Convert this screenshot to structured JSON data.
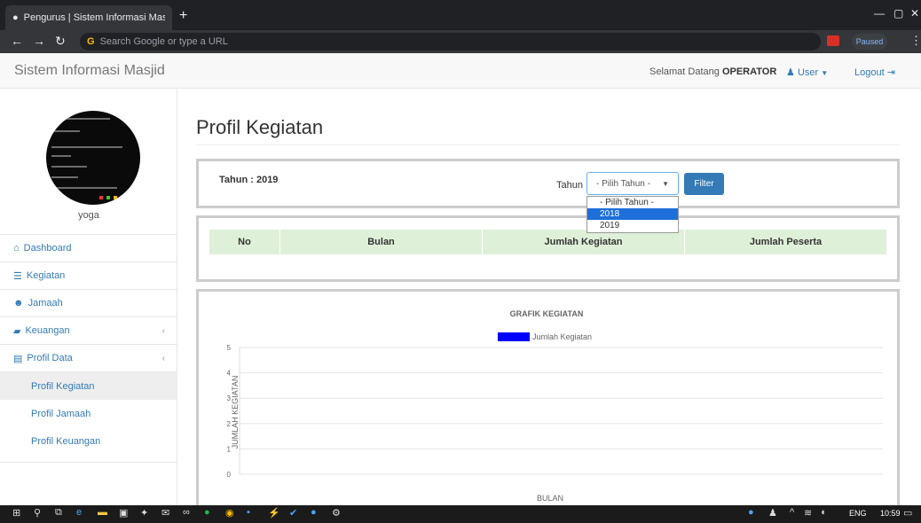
{
  "browser": {
    "tab_title": "Pengurus | Sistem Informasi Mas ×",
    "omnibox_placeholder": "Search Google or type a URL",
    "paused_label": "Paused"
  },
  "header": {
    "brand": "Sistem Informasi Masjid",
    "welcome_prefix": "Selamat Datang",
    "welcome_user": "OPERATOR",
    "user_menu": "User",
    "logout": "Logout"
  },
  "sidebar": {
    "username": "yoga",
    "items": [
      {
        "label": "Dashboard",
        "icon": "home-icon"
      },
      {
        "label": "Kegiatan",
        "icon": "list-icon"
      },
      {
        "label": "Jamaah",
        "icon": "users-icon"
      },
      {
        "label": "Keuangan",
        "icon": "book-icon"
      },
      {
        "label": "Profil Data",
        "icon": "file-icon"
      }
    ],
    "subitems": [
      {
        "label": "Profil Kegiatan"
      },
      {
        "label": "Profil Jamaah"
      },
      {
        "label": "Profil Keuangan"
      }
    ]
  },
  "main": {
    "title": "Profil Kegiatan",
    "tahun_label": "Tahun : 2019",
    "filter_label": "Tahun",
    "select_value": "- Pilih Tahun -",
    "filter_button": "Filter",
    "dropdown_options": [
      "- Pilih Tahun -",
      "2018",
      "2019"
    ],
    "dropdown_selected_index": 1,
    "table_headers": [
      "No",
      "Bulan",
      "Jumlah Kegiatan",
      "Jumlah Peserta"
    ]
  },
  "chart_data": {
    "type": "bar",
    "title": "GRAFIK KEGIATAN",
    "xlabel": "BULAN",
    "ylabel": "JUMLAH KEGIATAN",
    "ylim": [
      0,
      5
    ],
    "yticks": [
      "0",
      "1",
      "2",
      "3",
      "4",
      "5"
    ],
    "series": [
      {
        "name": "Jumlah Kegiatan",
        "values": [],
        "color": "#0000ff"
      }
    ],
    "categories": [],
    "grid": true,
    "legend_position": "top"
  },
  "taskbar": {
    "lang": "ENG",
    "clock": "10:59"
  }
}
